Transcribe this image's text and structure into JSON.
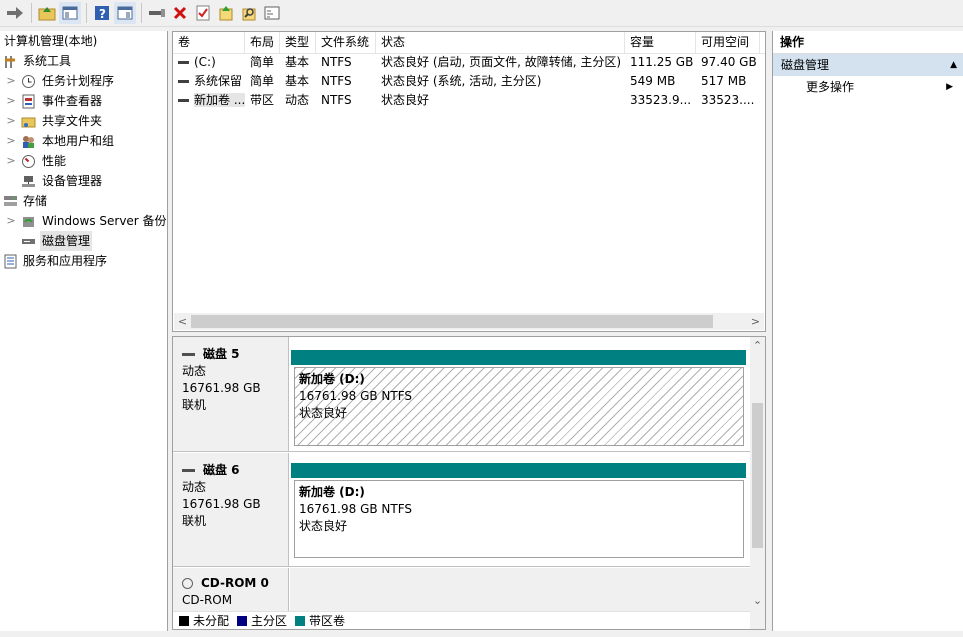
{
  "toolbar": {
    "buttons": [
      "back-forward",
      "up-folder",
      "show-hide-tree",
      "help",
      "properties",
      "connect",
      "delete",
      "check",
      "refresh",
      "search",
      "console"
    ]
  },
  "tree": {
    "root": "计算机管理(本地)",
    "items": [
      {
        "label": "系统工具",
        "level": 0,
        "expander": "",
        "icon": "tools-icon"
      },
      {
        "label": "任务计划程序",
        "level": 1,
        "expander": ">",
        "icon": "clock-icon"
      },
      {
        "label": "事件查看器",
        "level": 1,
        "expander": ">",
        "icon": "event-viewer-icon"
      },
      {
        "label": "共享文件夹",
        "level": 1,
        "expander": ">",
        "icon": "shared-folder-icon"
      },
      {
        "label": "本地用户和组",
        "level": 1,
        "expander": ">",
        "icon": "users-icon"
      },
      {
        "label": "性能",
        "level": 1,
        "expander": ">",
        "icon": "performance-icon"
      },
      {
        "label": "设备管理器",
        "level": 1,
        "expander": "",
        "icon": "device-manager-icon"
      },
      {
        "label": "存储",
        "level": 0,
        "expander": "",
        "icon": "storage-icon"
      },
      {
        "label": "Windows Server 备份",
        "level": 1,
        "expander": ">",
        "icon": "backup-icon"
      },
      {
        "label": "磁盘管理",
        "level": 1,
        "expander": "",
        "icon": "disk-icon",
        "selected": true
      },
      {
        "label": "服务和应用程序",
        "level": 0,
        "expander": "",
        "icon": "services-icon"
      }
    ]
  },
  "volumes": {
    "headers": [
      "卷",
      "布局",
      "类型",
      "文件系统",
      "状态",
      "容量",
      "可用空间"
    ],
    "rows": [
      [
        "(C:)",
        "简单",
        "基本",
        "NTFS",
        "状态良好 (启动, 页面文件, 故障转储, 主分区)",
        "111.25 GB",
        "97.40 GB"
      ],
      [
        "系统保留",
        "简单",
        "基本",
        "NTFS",
        "状态良好 (系统, 活动, 主分区)",
        "549 MB",
        "517 MB"
      ],
      [
        "新加卷 ...",
        "带区",
        "动态",
        "NTFS",
        "状态良好",
        "33523.9...",
        "33523...."
      ]
    ]
  },
  "disks": [
    {
      "name": "磁盘 5",
      "type": "动态",
      "size": "16761.98 GB",
      "status": "联机",
      "partition": {
        "label": "新加卷 (D:)",
        "size_fs": "16761.98 GB NTFS",
        "status": "状态良好",
        "selected": true
      }
    },
    {
      "name": "磁盘 6",
      "type": "动态",
      "size": "16761.98 GB",
      "status": "联机",
      "partition": {
        "label": "新加卷 (D:)",
        "size_fs": "16761.98 GB NTFS",
        "status": "状态良好",
        "selected": false
      }
    },
    {
      "name": "CD-ROM 0",
      "type": "CD-ROM"
    }
  ],
  "legend": [
    {
      "label": "未分配",
      "color": "#000000"
    },
    {
      "label": "主分区",
      "color": "#000080"
    },
    {
      "label": "带区卷",
      "color": "#008080"
    }
  ],
  "actions": {
    "title": "操作",
    "section": "磁盘管理",
    "more": "更多操作"
  },
  "colors": {
    "striped": "#008080",
    "section_bg": "#d4e2f0"
  }
}
